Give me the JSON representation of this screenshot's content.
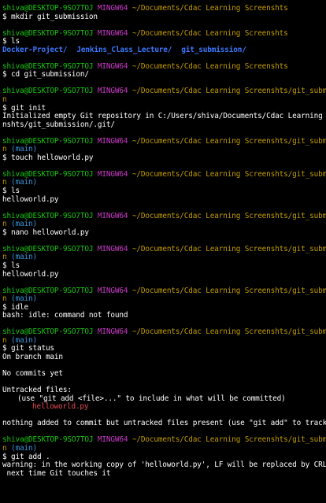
{
  "prompt": {
    "user_host": "shiva@DESKTOP-9SO7TOJ",
    "shell": "MINGW64",
    "path_base": "~/Documents/Cdac Learning Screenshts",
    "path_repo_wrapped": "~/Documents/Cdac Learning Screenshts/git_submissio",
    "path_repo_tail": "n",
    "branch": "(main)"
  },
  "blocks": {
    "b1": {
      "command": "$ mkdir git_submission"
    },
    "b2": {
      "command": "$ ls",
      "items": [
        "Docker-Project/",
        "Jenkins_Class_Lecture/",
        "git_submission/"
      ]
    },
    "b3": {
      "command": "$ cd git_submission/"
    },
    "b4": {
      "command": "$ git init",
      "output_line1": "Initialized empty Git repository in C:/Users/shiva/Documents/Cdac Learning Scree",
      "output_line2": "nshts/git_submission/.git/"
    },
    "b5": {
      "command": "$ touch helloworld.py"
    },
    "b6": {
      "command": "$ ls",
      "output": "helloworld.py"
    },
    "b7": {
      "command": "$ nano helloworld.py"
    },
    "b8": {
      "command": "$ ls",
      "output": "helloworld.py"
    },
    "b9": {
      "command": "$ idle",
      "output": "bash: idle: command not found"
    },
    "b10": {
      "command": "$ git status",
      "on_branch": "On branch main",
      "no_commits": "No commits yet",
      "untracked_header": "Untracked files:",
      "untracked_hint": "(use \"git add <file>...\" to include in what will be committed)",
      "untracked_file": "helloworld.py",
      "summary": "nothing added to commit but untracked files present (use \"git add\" to track)"
    },
    "b11": {
      "command": "$ git add .",
      "warning_line1": "warning: in the working copy of 'helloworld.py', LF will be replaced by CRLF the",
      "warning_line2": " next time Git touches it"
    }
  },
  "colors": {
    "background": "#000000",
    "text": "#ffffff",
    "user_host": "#16c60c",
    "shell": "#c839c5",
    "path": "#c19c00",
    "branch": "#3a96dd",
    "directory": "#3b78ff",
    "untracked_file": "#e74856"
  }
}
